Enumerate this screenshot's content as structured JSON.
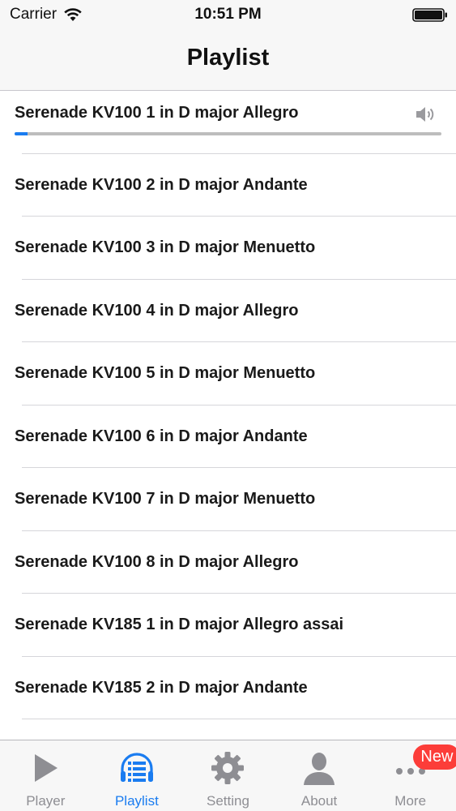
{
  "status_bar": {
    "carrier": "Carrier",
    "time": "10:51 PM"
  },
  "nav": {
    "title": "Playlist"
  },
  "playlist": {
    "now_playing_index": 0,
    "progress": 0.03,
    "items": [
      {
        "title": "Serenade KV100 1 in D major Allegro"
      },
      {
        "title": "Serenade KV100 2 in D major Andante"
      },
      {
        "title": "Serenade KV100 3 in D major Menuetto"
      },
      {
        "title": "Serenade KV100 4 in D major Allegro"
      },
      {
        "title": "Serenade KV100 5 in D major Menuetto"
      },
      {
        "title": "Serenade KV100 6 in D major Andante"
      },
      {
        "title": "Serenade KV100 7 in D major Menuetto"
      },
      {
        "title": "Serenade KV100 8 in D major Allegro"
      },
      {
        "title": "Serenade KV185 1 in D major Allegro assai"
      },
      {
        "title": "Serenade KV185 2 in D major Andante"
      }
    ]
  },
  "tab_bar": {
    "active": "playlist",
    "tabs": [
      {
        "id": "player",
        "label": "Player",
        "icon": "play-icon"
      },
      {
        "id": "playlist",
        "label": "Playlist",
        "icon": "playlist-icon"
      },
      {
        "id": "setting",
        "label": "Setting",
        "icon": "gear-icon"
      },
      {
        "id": "about",
        "label": "About",
        "icon": "person-icon"
      },
      {
        "id": "more",
        "label": "More",
        "icon": "more-icon",
        "badge": "New"
      }
    ]
  },
  "colors": {
    "accent": "#1a7cf0",
    "inactive": "#8e8e93",
    "badge": "#fc3d39"
  }
}
